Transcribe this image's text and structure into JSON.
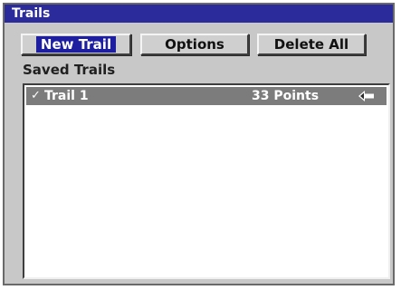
{
  "window": {
    "title": "Trails"
  },
  "toolbar": {
    "new_label": "New Trail",
    "options_label": "Options",
    "delete_all_label": "Delete All"
  },
  "list": {
    "label": "Saved Trails",
    "items": [
      {
        "checked": true,
        "check_icon": "checkmark-icon",
        "name": "Trail 1",
        "points": "33 Points",
        "action_icon": "left-arrow-icon"
      }
    ]
  },
  "colors": {
    "titlebar": "#2b2b9c",
    "window_bg": "#c8c8c8",
    "selected_row": "#7c7c7c",
    "focus_highlight": "#1e1ea0"
  }
}
